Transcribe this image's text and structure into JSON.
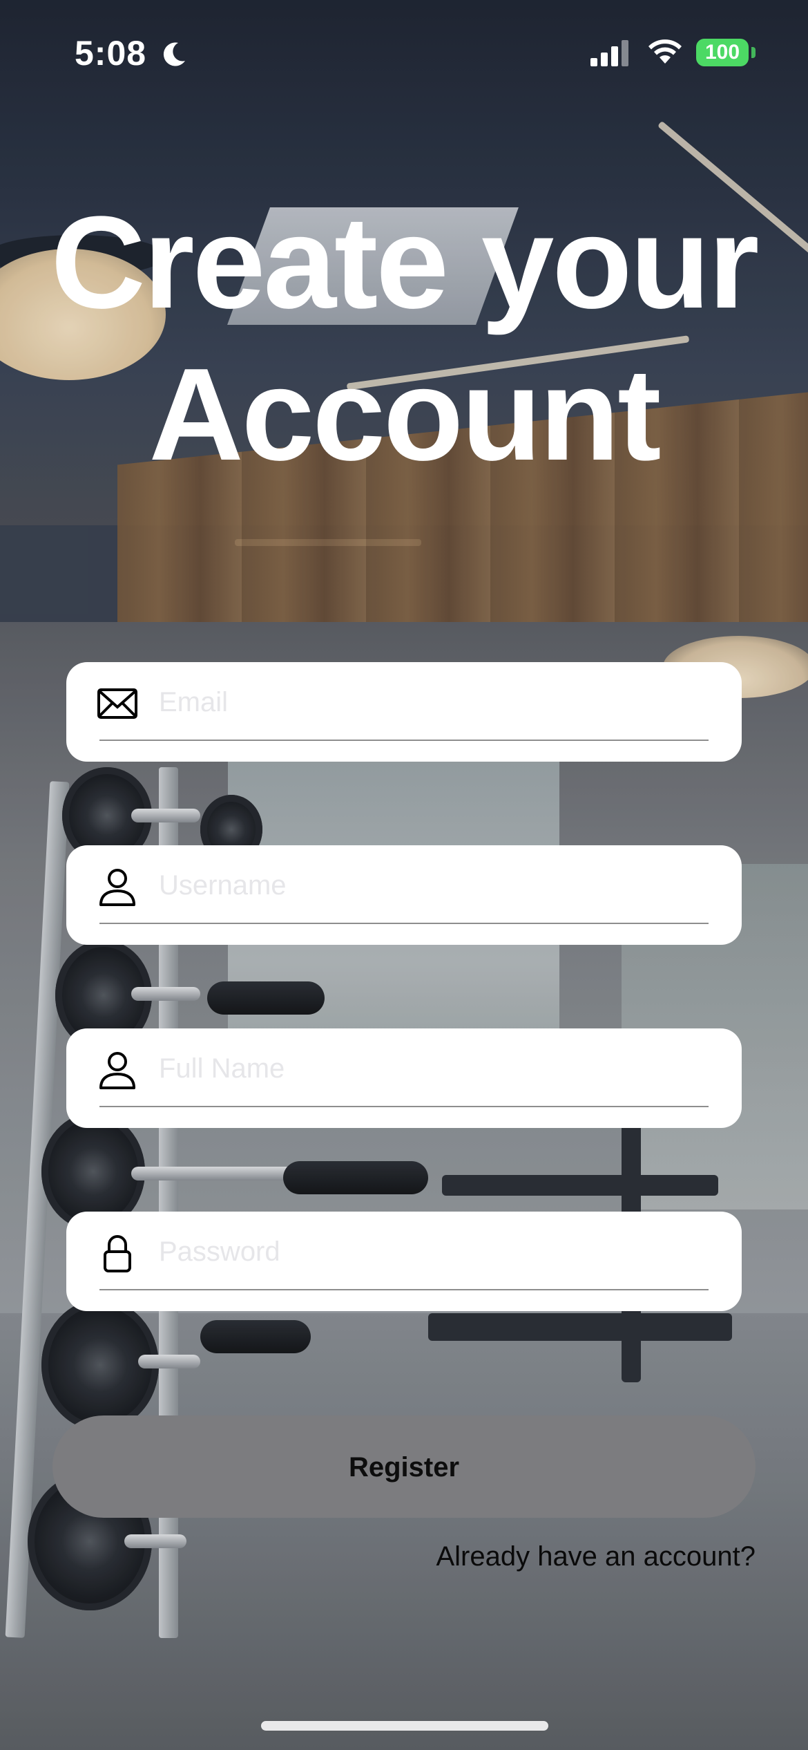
{
  "status_bar": {
    "time": "5:08",
    "battery": "100",
    "battery_color": "#4cd964",
    "icons": [
      "moon-icon",
      "signal-icon",
      "wifi-icon",
      "battery-icon"
    ]
  },
  "title": {
    "line1": "Create your",
    "line2": "Account"
  },
  "form": {
    "fields": [
      {
        "placeholder": "Email",
        "value": "",
        "icon": "envelope-icon"
      },
      {
        "placeholder": "Username",
        "value": "",
        "icon": "person-icon"
      },
      {
        "placeholder": "Full Name",
        "value": "",
        "icon": "person-icon"
      },
      {
        "placeholder": "Password",
        "value": "",
        "icon": "lock-icon"
      }
    ],
    "register_label": "Register",
    "register_color": "#7c7c7f",
    "login_link": "Already have an account?"
  }
}
